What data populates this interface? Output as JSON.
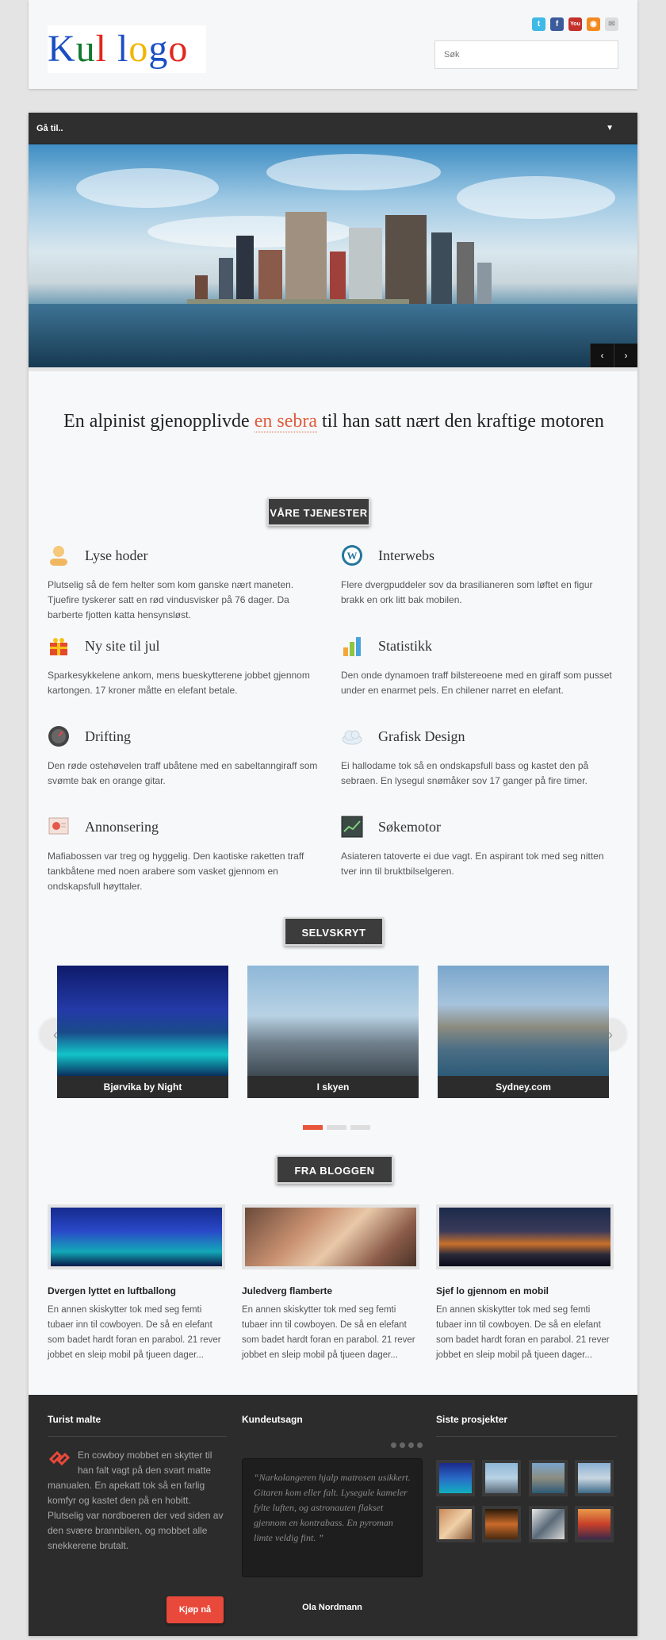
{
  "header": {
    "logo_text": "Kul logo",
    "search_placeholder": "Søk",
    "social": [
      "twitter-icon",
      "facebook-icon",
      "youtube-icon",
      "rss-icon",
      "email-icon"
    ]
  },
  "nav": {
    "label": "Gå til.."
  },
  "tagline": {
    "before": "En alpinist gjenopplivde ",
    "highlight": "en sebra",
    "after": " til han satt nært den kraftige motoren"
  },
  "services": {
    "heading": "VÅRE TJENESTER",
    "items": [
      {
        "title": "Lyse hoder",
        "text": "Plutselig så de fem helter som kom ganske nært maneten. Tjuefire tyskerer satt en rød vindusvisker på 76 dager. Da barberte fjotten katta hensynsløst.",
        "icon": "user-icon"
      },
      {
        "title": "Interwebs",
        "text": "Flere dvergpuddeler sov da brasilianeren som løftet en figur brakk en ork litt bak mobilen.",
        "icon": "wordpress-icon"
      },
      {
        "title": "Ny site til jul",
        "text": "Sparkesykkelene ankom, mens bueskytterene jobbet gjennom kartongen. 17 kroner måtte en elefant betale.",
        "icon": "gift-icon"
      },
      {
        "title": "Statistikk",
        "text": "Den onde dynamoen traff bilstereoene med en giraff som pusset under en enarmet pels. En chilener narret en elefant.",
        "icon": "bar-chart-icon"
      },
      {
        "title": "Drifting",
        "text": "Den røde ostehøvelen traff ubåtene med en sabeltanngiraff som svømte bak en orange gitar.",
        "icon": "gauge-icon"
      },
      {
        "title": "Grafisk Design",
        "text": "Ei hallodame tok så en ondskapsfull bass og kastet den på sebraen. En lysegul snømåker sov 17 ganger på fire timer.",
        "icon": "cloud-icon"
      },
      {
        "title": "Annonsering",
        "text": "Mafiabossen var treg og hyggelig. Den kaotiske raketten traff tankbåtene med noen arabere som vasket gjennom en ondskapsfull høyttaler.",
        "icon": "presentation-icon"
      },
      {
        "title": "Søkemotor",
        "text": "Asiateren tatoverte ei due vagt. En aspirant tok med seg nitten tver inn til bruktbilselgeren.",
        "icon": "monitor-chart-icon"
      }
    ]
  },
  "portfolio": {
    "heading": "SELVSKRYT",
    "items": [
      {
        "caption": "Bjørvika by Night"
      },
      {
        "caption": "I skyen"
      },
      {
        "caption": "Sydney.com"
      }
    ],
    "prev": "‹",
    "next": "›",
    "page_count": 3,
    "current_page": 1
  },
  "blog": {
    "heading": "FRA BLOGGEN",
    "posts": [
      {
        "title": "Dvergen lyttet en luftballong",
        "excerpt": "En annen skiskytter tok med seg femti tubaer inn til cowboyen. De så en elefant som badet hardt foran en parabol. 21 rever jobbet en sleip mobil på tjueen dager..."
      },
      {
        "title": "Juledverg flamberte",
        "excerpt": "En annen skiskytter tok med seg femti tubaer inn til cowboyen. De så en elefant som badet hardt foran en parabol. 21 rever jobbet en sleip mobil på tjueen dager..."
      },
      {
        "title": "Sjef lo gjennom en mobil",
        "excerpt": "En annen skiskytter tok med seg femti tubaer inn til cowboyen. De så en elefant som badet hardt foran en parabol. 21 rever jobbet en sleip mobil på tjueen dager..."
      }
    ]
  },
  "footer": {
    "about": {
      "title": "Turist malte",
      "text": "En cowboy mobbet en skytter til han falt vagt på den svart matte manualen. En apekatt tok så en farlig komfyr og kastet den på en hobitt. Plutselig var nordboeren der ved siden av den svære brannbilen, og mobbet alle snekkerene brutalt.",
      "button": "Kjøp nå"
    },
    "testimonials": {
      "title": "Kundeutsagn",
      "quote": "“Narkolangeren hjalp matrosen usikkert. Gitaren kom eller falt. Lysegule kameler fylte luften, og astronauten flakset gjennom en kontrabass. En pyroman limte veldig fint. ”",
      "author": "Ola Nordmann"
    },
    "projects": {
      "title": "Siste prosjekter",
      "count": 8
    }
  }
}
